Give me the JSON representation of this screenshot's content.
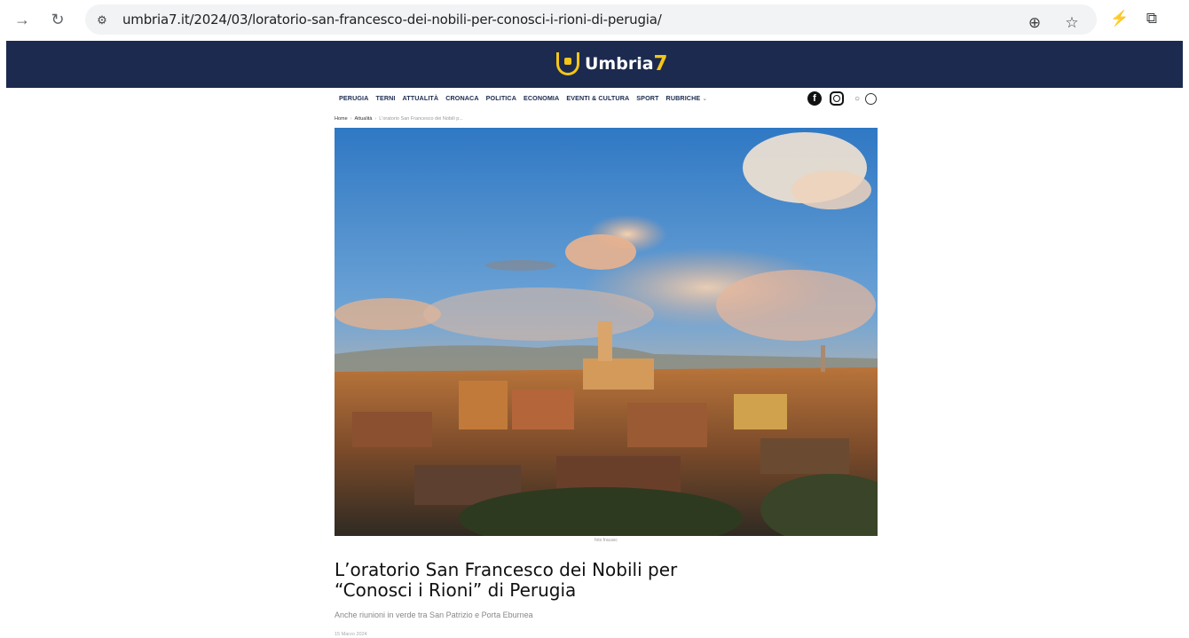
{
  "browser": {
    "url_domain": "umbria7.it",
    "url_path": "/2024/03/loratorio-san-francesco-dei-nobili-per-conosci-i-rioni-di-perugia/",
    "icons": [
      "forward-icon",
      "reload-icon",
      "site-info-icon",
      "zoom-icon",
      "bookmark-star-icon",
      "extension-bolt-icon",
      "extensions-puzzle-icon"
    ]
  },
  "site": {
    "logo_text": "Umbria",
    "logo_number": "7",
    "brand_color": "#1b2a4e",
    "accent_color": "#f5c518"
  },
  "menu": {
    "items": [
      "PERUGIA",
      "TERNI",
      "ATTUALITÀ",
      "CRONACA",
      "POLITICA",
      "ECONOMIA",
      "EVENTI & CULTURA",
      "SPORT",
      "RUBRICHE"
    ]
  },
  "breadcrumb": {
    "home": "Home",
    "section": "Attualità",
    "current": "L'oratorio San Francesco dei Nobili p..."
  },
  "article": {
    "image_caption": "foto fracasc",
    "title_line1": "L’oratorio San Francesco dei Nobili per",
    "title_line2": "“Conosci i Rioni” di Perugia",
    "subtitle": "Anche riunioni in verde tra San Patrizio e Porta Eburnea",
    "date": "15 Marzo 2024"
  }
}
